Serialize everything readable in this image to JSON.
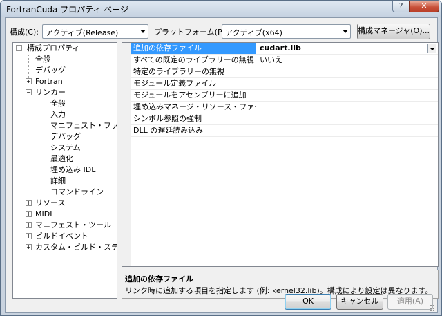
{
  "window": {
    "title": "FortranCuda プロパティ ページ",
    "help_label": "?",
    "close_label": "✕"
  },
  "toolbar": {
    "config_label": "構成(C):",
    "config_value": "アクティブ(Release)",
    "platform_label": "プラットフォーム(P):",
    "platform_value": "アクティブ(x64)",
    "config_manager_label": "構成マネージャ(O)..."
  },
  "tree": {
    "items": [
      {
        "label": "構成プロパティ",
        "expander": "−"
      },
      {
        "label": "全般"
      },
      {
        "label": "デバッグ"
      },
      {
        "label": "Fortran",
        "expander": "+"
      },
      {
        "label": "リンカー",
        "expander": "−"
      },
      {
        "label": "全般"
      },
      {
        "label": "入力"
      },
      {
        "label": "マニフェスト・ファイル"
      },
      {
        "label": "デバッグ"
      },
      {
        "label": "システム"
      },
      {
        "label": "最適化"
      },
      {
        "label": "埋め込み IDL"
      },
      {
        "label": "詳細"
      },
      {
        "label": "コマンドライン"
      },
      {
        "label": "リソース",
        "expander": "+"
      },
      {
        "label": "MIDL",
        "expander": "+"
      },
      {
        "label": "マニフェスト・ツール",
        "expander": "+"
      },
      {
        "label": "ビルドイベント",
        "expander": "+"
      },
      {
        "label": "カスタム・ビルド・ステップ",
        "expander": "+"
      }
    ]
  },
  "grid": {
    "rows": [
      {
        "name": "追加の依存ファイル",
        "value": "cudart.lib"
      },
      {
        "name": "すべての既定のライブラリーの無視",
        "value": "いいえ"
      },
      {
        "name": "特定のライブラリーの無視",
        "value": ""
      },
      {
        "name": "モジュール定義ファイル",
        "value": ""
      },
      {
        "name": "モジュールをアセンブリーに追加",
        "value": ""
      },
      {
        "name": "埋め込みマネージ・リソース・ファイル",
        "value": ""
      },
      {
        "name": "シンボル参照の強制",
        "value": ""
      },
      {
        "name": "DLL の遅延読み込み",
        "value": ""
      }
    ]
  },
  "description": {
    "title": "追加の依存ファイル",
    "text": "リンク時に追加する項目を指定します (例: kernel32.lib)。構成により設定は異なります。"
  },
  "buttons": {
    "ok": "OK",
    "cancel": "キャンセル",
    "apply": "適用(A)"
  },
  "colors": {
    "selection": "#3399ff",
    "close_button": "#c8513a"
  }
}
